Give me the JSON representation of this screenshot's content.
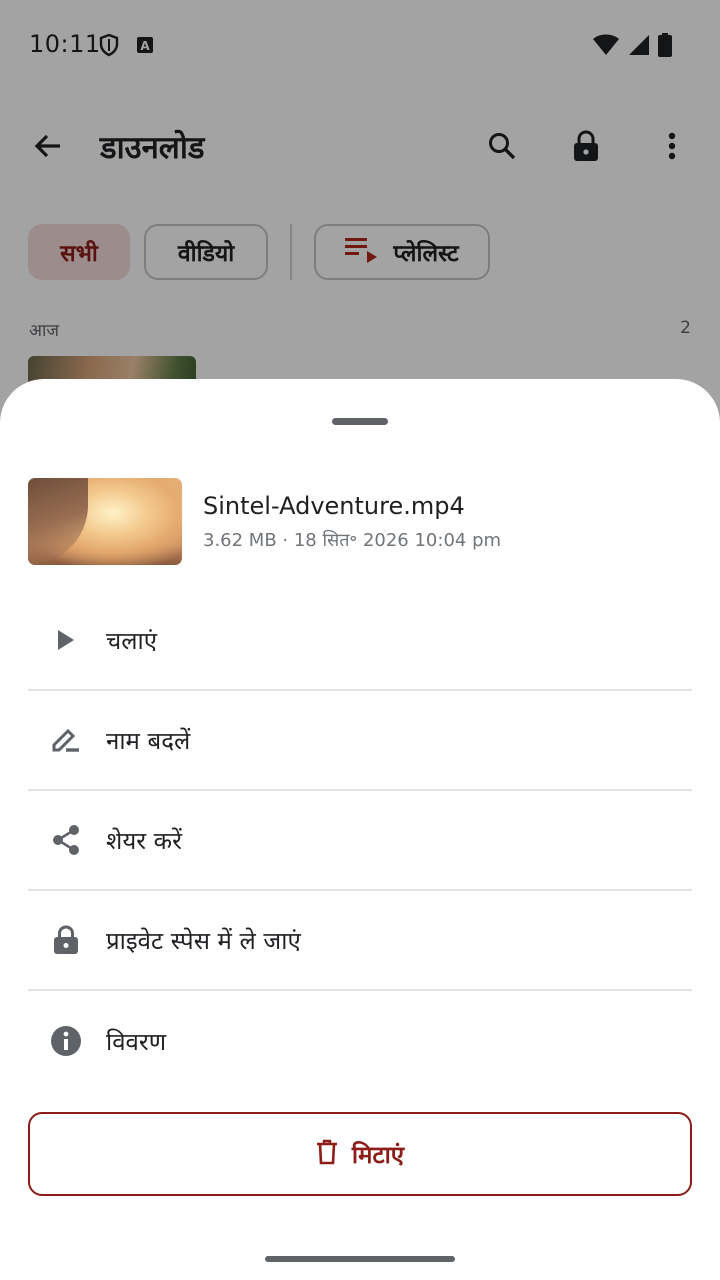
{
  "status_bar": {
    "time": "10:11",
    "icons": [
      "shield-icon",
      "keyboard-a-icon",
      "wifi-icon",
      "signal-icon",
      "battery-icon"
    ]
  },
  "app_bar": {
    "title": "डाउनलोड",
    "icons": [
      "back-arrow-icon",
      "search-icon",
      "lock-icon",
      "more-vert-icon"
    ]
  },
  "filters": {
    "all": "सभी",
    "video": "वीडियो",
    "playlist": "प्लेलिस्ट",
    "selected": "सभी"
  },
  "section": {
    "label": "आज",
    "count": "2"
  },
  "sheet": {
    "file_name": "Sintel-Adventure.mp4",
    "file_meta": "3.62 MB · 18 सित॰ 2026 10:04 pm",
    "actions": [
      {
        "icon": "play-icon",
        "label": "चलाएं"
      },
      {
        "icon": "edit-icon",
        "label": "नाम बदलें"
      },
      {
        "icon": "share-icon",
        "label": "शेयर करें"
      },
      {
        "icon": "lock-icon",
        "label": "प्राइवेट स्पेस में ले जाएं"
      },
      {
        "icon": "info-icon",
        "label": "विवरण"
      }
    ],
    "delete_label": "मिटाएं"
  },
  "colors": {
    "accent": "#8c1d18",
    "chip_selected_bg": "#f6dcdc",
    "icon_grey": "#5f6368",
    "text_primary": "#202124"
  }
}
